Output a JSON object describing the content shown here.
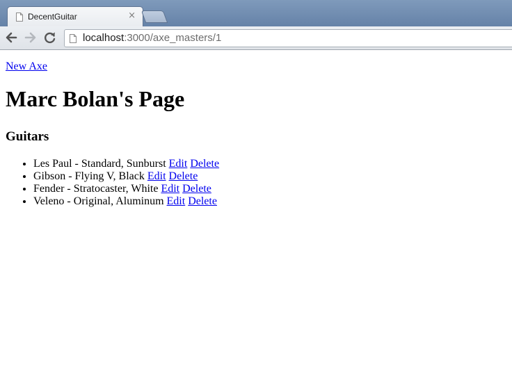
{
  "browser": {
    "tab": {
      "title": "DecentGuitar",
      "close_glyph": "×"
    },
    "address": {
      "host": "localhost",
      "path": ":3000/axe_masters/1"
    },
    "icons": [
      "page-icon",
      "close-icon",
      "new-tab-icon",
      "back-arrow-icon",
      "forward-arrow-icon",
      "reload-icon"
    ]
  },
  "page": {
    "new_link": "New Axe",
    "title": "Marc Bolan's Page",
    "section_heading": "Guitars",
    "guitars": [
      {
        "description": "Les Paul - Standard, Sunburst",
        "edit": "Edit",
        "delete": "Delete"
      },
      {
        "description": "Gibson - Flying V, Black",
        "edit": "Edit",
        "delete": "Delete"
      },
      {
        "description": "Fender - Stratocaster, White",
        "edit": "Edit",
        "delete": "Delete"
      },
      {
        "description": "Veleno - Original, Aluminum",
        "edit": "Edit",
        "delete": "Delete"
      }
    ]
  },
  "colors": {
    "link": "#0000ee",
    "tabstrip": "#6e8ab0"
  }
}
